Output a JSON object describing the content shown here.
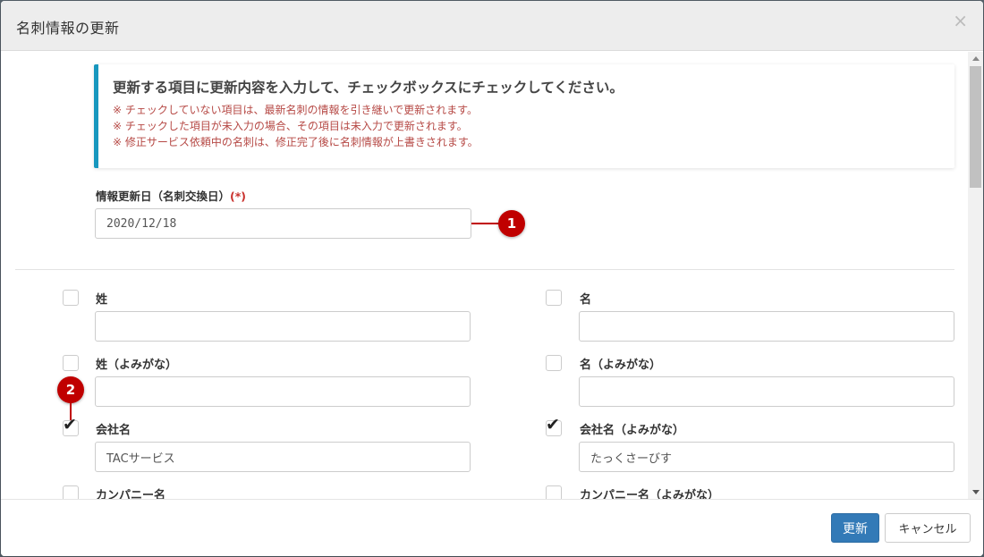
{
  "dialog": {
    "title": "名刺情報の更新",
    "close_symbol": "×"
  },
  "notice": {
    "heading": "更新する項目に更新内容を入力して、チェックボックスにチェックしてください。",
    "lines": [
      "※ チェックしていない項目は、最新名刺の情報を引き継いで更新されます。",
      "※ チェックした項目が未入力の場合、その項目は未入力で更新されます。",
      "※ 修正サービス依頼中の名刺は、修正完了後に名刺情報が上書きされます。"
    ]
  },
  "update_date": {
    "label": "情報更新日（名刺交換日）",
    "required_mark": "(*)",
    "value": "2020/12/18"
  },
  "callouts": [
    "1",
    "2"
  ],
  "fields": [
    {
      "label": "姓",
      "value": "",
      "checked": false
    },
    {
      "label": "名",
      "value": "",
      "checked": false
    },
    {
      "label": "姓（よみがな）",
      "value": "",
      "checked": false
    },
    {
      "label": "名（よみがな）",
      "value": "",
      "checked": false
    },
    {
      "label": "会社名",
      "value": "TACサービス",
      "checked": true
    },
    {
      "label": "会社名（よみがな）",
      "value": "たっくさーびす",
      "checked": true
    },
    {
      "label": "カンパニー名",
      "value": "",
      "checked": false
    },
    {
      "label": "カンパニー名（よみがな）",
      "value": "",
      "checked": false
    }
  ],
  "check_symbol": "✔",
  "footer": {
    "update_label": "更新",
    "cancel_label": "キャンセル"
  },
  "colors": {
    "primary": "#337ab7",
    "notice_accent": "#1797be",
    "notice_text": "#b64945",
    "callout": "#c00000"
  }
}
